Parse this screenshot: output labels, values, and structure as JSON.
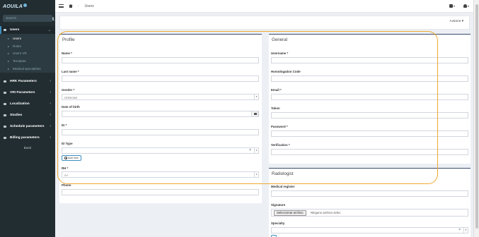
{
  "app": {
    "logo": "AOUILA"
  },
  "sidebar": {
    "search_placeholder": "Search",
    "items": [
      {
        "label": "Users",
        "open": true,
        "sub": [
          "Users",
          "Roles",
          "Users VR",
          "Template",
          "Medical specialities"
        ]
      },
      {
        "label": "HRK Parameters"
      },
      {
        "label": "VRI Parameters"
      },
      {
        "label": "Localization"
      },
      {
        "label": "Studies"
      },
      {
        "label": "Schedule parameters"
      },
      {
        "label": "Billing parameters"
      }
    ],
    "back": "Back"
  },
  "header": {
    "breadcrumb": "Users"
  },
  "actions": {
    "label": "Actions"
  },
  "profile": {
    "title": "Profile",
    "name_label": "Name *",
    "lastname_label": "Last name *",
    "gender_label": "Gender *",
    "gender_value": "Unknown",
    "dob_label": "Date of birth",
    "id_label": "ID *",
    "idtype_label": "ID Type",
    "addnew_label": "Add new",
    "rh_label": "RH *",
    "rh_value": "A+",
    "phone_label": "Phone"
  },
  "general": {
    "title": "General",
    "username_label": "Username *",
    "homologation_label": "Homologation Code",
    "email_label": "Email *",
    "token_label": "Token",
    "password_label": "Password *",
    "verification_label": "Verification *"
  },
  "radiologist": {
    "title": "Radiologist",
    "medical_register_label": "Medical register",
    "signature_label": "Signature",
    "file_button": "Seleccionar archivo",
    "file_status": "Ninguno archivo selec.",
    "specialty_label": "Specialty"
  }
}
